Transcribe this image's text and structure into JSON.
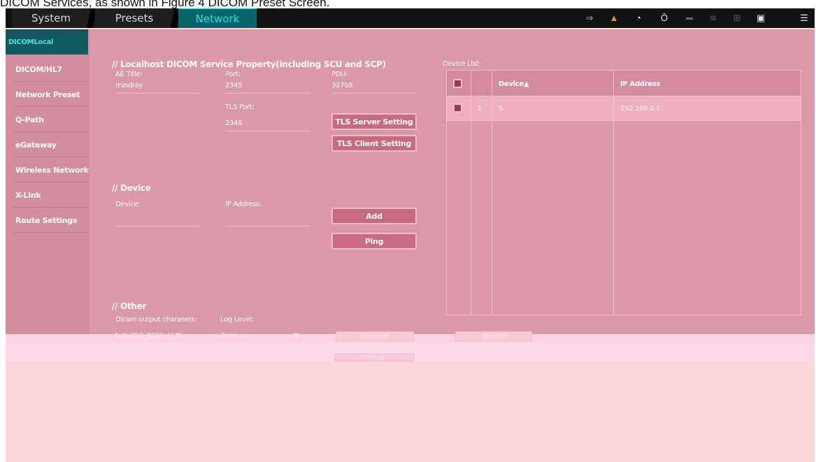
{
  "caption": "DICOM Services, as shown in Figure 4 DICOM Preset Screen.",
  "tabs": [
    {
      "label": "System"
    },
    {
      "label": "Presets"
    },
    {
      "label": "Network"
    }
  ],
  "tray_icons": [
    "input-icon",
    "warning-icon",
    "power-icon",
    "mouse-icon",
    "storage-icon",
    "wifi-icon",
    "network-icon",
    "printer-icon",
    "menu-icon"
  ],
  "sidebar": {
    "active": "DICOMLocal",
    "items": [
      {
        "label": "DICOM/HL7"
      },
      {
        "label": "Network Preset"
      },
      {
        "label": "Q-Path"
      },
      {
        "label": "eGateway"
      },
      {
        "label": "Wireless Network"
      },
      {
        "label": "X-Link"
      },
      {
        "label": "Route Settings"
      }
    ]
  },
  "local": {
    "section_title": "Localhost DICOM Service Property(including SCU and SCP)",
    "ae_title_label": "AE Title:",
    "ae_title_value": "mindray",
    "port_label": "Port:",
    "port_value": "2345",
    "pdu_label": "PDU:",
    "pdu_value": "32768",
    "tls_port_label": "TLS Port:",
    "tls_port_value": "2346",
    "tls_server_button": "TLS Server Setting",
    "tls_client_button": "TLS Client Setting"
  },
  "device": {
    "section_title": "Device",
    "device_label": "Device:",
    "ip_label": "IP Address:",
    "add_button": "Add",
    "ping_button": "Ping"
  },
  "other": {
    "section_title": "Other",
    "charset_label": "Dicom output charasets:",
    "charset_value": "Auto(ISO_8859_1)",
    "loglevel_label": "Log Level:",
    "loglevel_value": "Error",
    "capture_button": "Capture",
    "settings_button": "Setting"
  },
  "device_list": {
    "title": "Device List:",
    "columns": [
      "Device",
      "IP Address"
    ],
    "sort_indicator": "▲",
    "rows": [
      {
        "index": "1",
        "device": "S",
        "ip": "192.168.0.1"
      }
    ],
    "delete_button": "Delete"
  },
  "colors": {
    "active_tab": "#08646a",
    "active_text": "#22e0e8",
    "overlay": "#db98a6"
  }
}
